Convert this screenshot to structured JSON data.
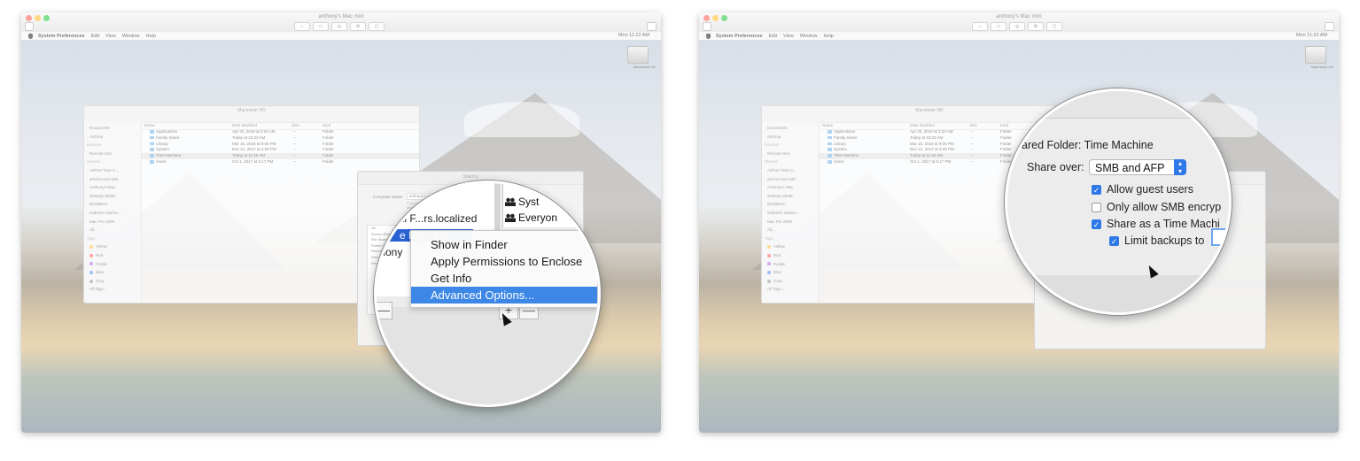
{
  "vm": {
    "window_title": "anthony's Mac mini",
    "menubar": {
      "app": "System Preferences",
      "items": [
        "Edit",
        "View",
        "Window",
        "Help"
      ],
      "clock": "Mon 11:22 AM"
    },
    "hd_label": "Macintosh HD"
  },
  "finder": {
    "title": "Macintosh HD",
    "sidebar": [
      "Documents",
      "AirDrop",
      "Devices",
      "Remote Disc",
      "Shared",
      "AirPort Time C...",
      "amd-8-core-64b",
      "Anthony's Mac",
      "desktop-3hd9n",
      "Distillation",
      "Gabriel's Macbo...",
      "Mac Pro 2009",
      "All...",
      "Tags",
      "Yellow",
      "Red",
      "Purple",
      "Blue",
      "Gray",
      "All Tags..."
    ],
    "tag_colors": [
      "#f5c33b",
      "#ff5f57",
      "#b36ae2",
      "#4f8ff0",
      "#9a9a9a"
    ],
    "columns": [
      "Name",
      "Date Modified",
      "Size",
      "Kind"
    ],
    "rows": [
      {
        "name": "Applications",
        "date": "Apr 20, 2018 at 3:34 AM",
        "size": "--",
        "kind": "Folder"
      },
      {
        "name": "Family Share",
        "date": "Today at 10:23 AM",
        "size": "--",
        "kind": "Folder"
      },
      {
        "name": "Library",
        "date": "Mar 16, 2018 at 9:05 PM",
        "size": "--",
        "kind": "Folder"
      },
      {
        "name": "System",
        "date": "Dec 21, 2017 at 4:09 PM",
        "size": "--",
        "kind": "Folder"
      },
      {
        "name": "Time Machine",
        "date": "Today at 11:19 AM",
        "size": "--",
        "kind": "Folder"
      },
      {
        "name": "Users",
        "date": "Oct 1, 2017 at 5:17 PM",
        "size": "--",
        "kind": "Folder"
      }
    ]
  },
  "sharing": {
    "title": "Sharing",
    "computer_name_label": "Computer Name:",
    "computer_name": "anthony's Mac mini",
    "computer_sub": "Computers on your local network can access your computer at: anthonys-Mac-mini.local",
    "services": [
      "On",
      "Service",
      "Screen Sharing",
      "File Sharing",
      "Printer Sharing",
      "Remote Login",
      "Remote Management",
      "Remote Apple Events",
      "Internet Sharing",
      "Bluetooth Sharing",
      "Content Caching"
    ]
  },
  "magnifier_left": {
    "shared_folders": [
      "re",
      "ial F...rs.localized",
      "e Machine",
      "thony"
    ],
    "users": [
      "Syst",
      "Everyon"
    ],
    "context_menu": [
      "Show in Finder",
      "Apply Permissions to Enclose",
      "Get Info",
      "Advanced Options..."
    ],
    "highlighted_index": 3,
    "plus": "+",
    "minus": "—"
  },
  "magnifier_right": {
    "shared_folder_line": "ared Folder: Time Machine",
    "share_over_label": "Share over:",
    "share_over_value": "SMB and AFP",
    "options": [
      {
        "label": "Allow guest users",
        "checked": true
      },
      {
        "label": "Only allow SMB encryp",
        "checked": false
      },
      {
        "label": "Share as a Time Machi",
        "checked": true
      },
      {
        "label": "Limit backups to",
        "checked": true
      }
    ]
  },
  "colors": {
    "accent": "#2f78e8",
    "highlight": "#3d87e6",
    "selection": "#2a62d4"
  },
  "icons": [
    "apple-icon",
    "folder-icon",
    "users-icon",
    "cursor-icon",
    "hard-drive-icon"
  ]
}
